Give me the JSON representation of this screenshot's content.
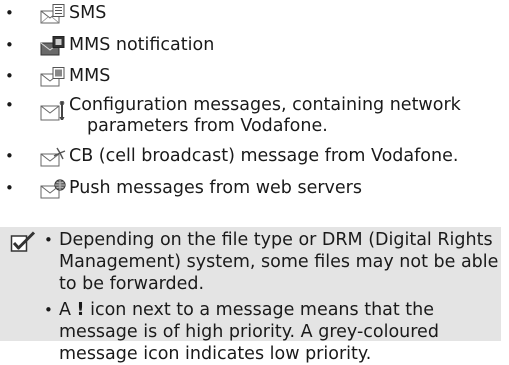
{
  "bullet_char": "•",
  "items": [
    {
      "icon": "sms-message-icon",
      "text": "SMS"
    },
    {
      "icon": "mms-notification-icon",
      "text": "MMS notification"
    },
    {
      "icon": "mms-message-icon",
      "text": "MMS"
    },
    {
      "icon": "configuration-message-icon",
      "text_line1": "Configuration messages, containing network",
      "text_line2": "parameters from Vodafone."
    },
    {
      "icon": "cell-broadcast-icon",
      "text": "CB (cell broadcast) message from Vodafone."
    },
    {
      "icon": "push-message-icon",
      "text": "Push messages from web servers"
    }
  ],
  "note": {
    "icon": "checkmark-note-icon",
    "items": [
      {
        "text": "Depending on the file type or DRM (Digital Rights Management) system, some files may not be able to be forwarded."
      },
      {
        "prefix": "A ",
        "bang": "!",
        "suffix": " icon next to a message means that the message is of high priority. A grey-coloured message icon indicates low priority."
      }
    ]
  }
}
